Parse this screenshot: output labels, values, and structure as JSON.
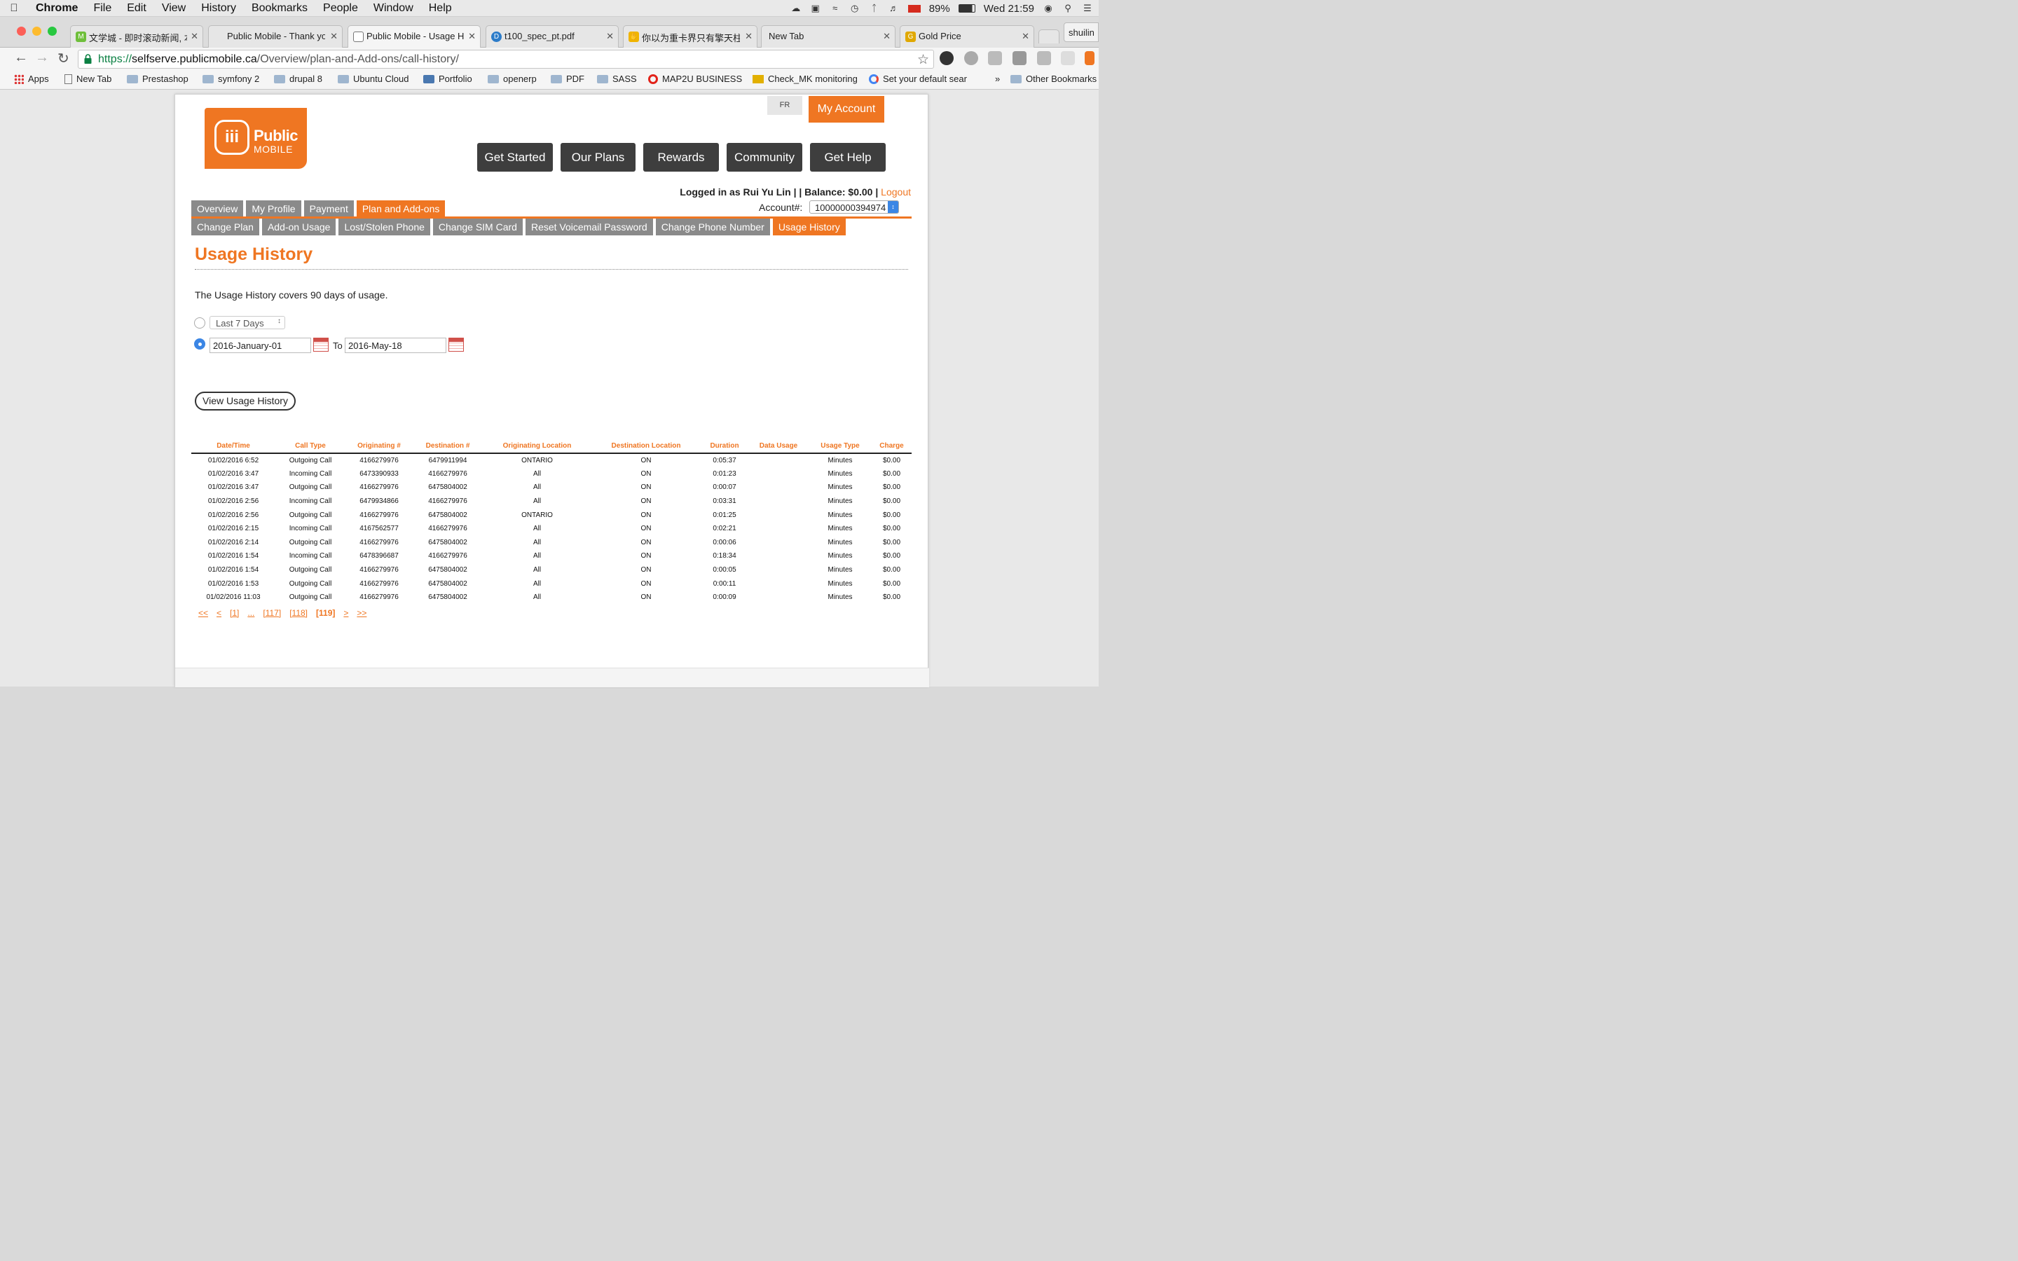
{
  "os_menubar": {
    "app": "Chrome",
    "items": [
      "File",
      "Edit",
      "View",
      "History",
      "Bookmarks",
      "People",
      "Window",
      "Help"
    ],
    "battery": "89%",
    "clock": "Wed 21:59"
  },
  "browser": {
    "tabs": [
      {
        "title": "文学城 - 即时滚动新闻, 本",
        "favicon_color": "#6fbf3b"
      },
      {
        "title": "Public Mobile - Thank yo",
        "favicon_color": "#ffffff"
      },
      {
        "title": "Public Mobile - Usage H",
        "favicon_color": "#ffffff",
        "active": true
      },
      {
        "title": "t100_spec_pt.pdf",
        "favicon_color": "#2c7cc9"
      },
      {
        "title": "你以为重卡界只有擎天柱?",
        "favicon_color": "#f0b400"
      },
      {
        "title": "New Tab",
        "favicon_color": "#ffffff"
      },
      {
        "title": "Gold Price",
        "favicon_color": "#e0a800"
      }
    ],
    "profile_name": "shuilin",
    "url": {
      "scheme": "https://",
      "host": "selfserve.publicmobile.ca",
      "path": "/Overview/plan-and-Add-ons/call-history/"
    },
    "bookmarks": [
      "Apps",
      "New Tab",
      "Prestashop",
      "symfony 2",
      "drupal 8",
      "Ubuntu Cloud",
      "Portfolio",
      "openerp",
      "PDF",
      "SASS",
      "MAP2U BUSINESS",
      "Check_MK monitoring",
      "Set your default sear"
    ],
    "bookmarks_more": "»",
    "other_bookmarks": "Other Bookmarks"
  },
  "site": {
    "logo": {
      "line1": "Public",
      "line2": "MOBILE"
    },
    "lang_button": "FR",
    "my_account": "My Account",
    "main_nav": [
      "Get Started",
      "Our Plans",
      "Rewards",
      "Community",
      "Get Help"
    ],
    "logged_in_text": "Logged in as Rui Yu Lin | | Balance: $0.00 |",
    "logout": "Logout",
    "account_label": "Account#:",
    "account_number": "10000000394974",
    "tabs_primary": [
      {
        "label": "Overview"
      },
      {
        "label": "My Profile"
      },
      {
        "label": "Payment"
      },
      {
        "label": "Plan and Add-ons",
        "active": true
      }
    ],
    "tabs_secondary": [
      {
        "label": "Change Plan"
      },
      {
        "label": "Add-on Usage"
      },
      {
        "label": "Lost/Stolen Phone"
      },
      {
        "label": "Change SIM Card"
      },
      {
        "label": "Reset Voicemail Password"
      },
      {
        "label": "Change Phone Number"
      },
      {
        "label": "Usage History",
        "active": true
      }
    ],
    "accent_color": "#ef7622"
  },
  "usage": {
    "title": "Usage History",
    "description": "The Usage History covers 90 days of usage.",
    "period_option": "Last 7 Days",
    "date_from": "2016-January-01",
    "to_label": "To",
    "date_to": "2016-May-18",
    "view_button": "View Usage History",
    "columns": [
      "Date/Time",
      "Call Type",
      "Originating #",
      "Destination #",
      "Originating Location",
      "Destination Location",
      "Duration",
      "Data Usage",
      "Usage Type",
      "Charge"
    ],
    "rows": [
      [
        "01/02/2016 6:52",
        "Outgoing Call",
        "4166279976",
        "6479911994",
        "ONTARIO",
        "ON",
        "0:05:37",
        "",
        "Minutes",
        "$0.00"
      ],
      [
        "01/02/2016 3:47",
        "Incoming Call",
        "6473390933",
        "4166279976",
        "All",
        "ON",
        "0:01:23",
        "",
        "Minutes",
        "$0.00"
      ],
      [
        "01/02/2016 3:47",
        "Outgoing Call",
        "4166279976",
        "6475804002",
        "All",
        "ON",
        "0:00:07",
        "",
        "Minutes",
        "$0.00"
      ],
      [
        "01/02/2016 2:56",
        "Incoming Call",
        "6479934866",
        "4166279976",
        "All",
        "ON",
        "0:03:31",
        "",
        "Minutes",
        "$0.00"
      ],
      [
        "01/02/2016 2:56",
        "Outgoing Call",
        "4166279976",
        "6475804002",
        "ONTARIO",
        "ON",
        "0:01:25",
        "",
        "Minutes",
        "$0.00"
      ],
      [
        "01/02/2016 2:15",
        "Incoming Call",
        "4167562577",
        "4166279976",
        "All",
        "ON",
        "0:02:21",
        "",
        "Minutes",
        "$0.00"
      ],
      [
        "01/02/2016 2:14",
        "Outgoing Call",
        "4166279976",
        "6475804002",
        "All",
        "ON",
        "0:00:06",
        "",
        "Minutes",
        "$0.00"
      ],
      [
        "01/02/2016 1:54",
        "Incoming Call",
        "6478396687",
        "4166279976",
        "All",
        "ON",
        "0:18:34",
        "",
        "Minutes",
        "$0.00"
      ],
      [
        "01/02/2016 1:54",
        "Outgoing Call",
        "4166279976",
        "6475804002",
        "All",
        "ON",
        "0:00:05",
        "",
        "Minutes",
        "$0.00"
      ],
      [
        "01/02/2016 1:53",
        "Outgoing Call",
        "4166279976",
        "6475804002",
        "All",
        "ON",
        "0:00:11",
        "",
        "Minutes",
        "$0.00"
      ],
      [
        "01/02/2016 11:03",
        "Outgoing Call",
        "4166279976",
        "6475804002",
        "All",
        "ON",
        "0:00:09",
        "",
        "Minutes",
        "$0.00"
      ]
    ],
    "pager": [
      {
        "label": "<<",
        "current": false
      },
      {
        "label": "<",
        "current": false
      },
      {
        "label": "[1]",
        "current": false
      },
      {
        "label": "...",
        "current": false
      },
      {
        "label": "[117]",
        "current": false
      },
      {
        "label": "[118]",
        "current": false
      },
      {
        "label": "[119]",
        "current": true
      },
      {
        "label": ">",
        "current": false
      },
      {
        "label": ">>",
        "current": false
      }
    ]
  }
}
